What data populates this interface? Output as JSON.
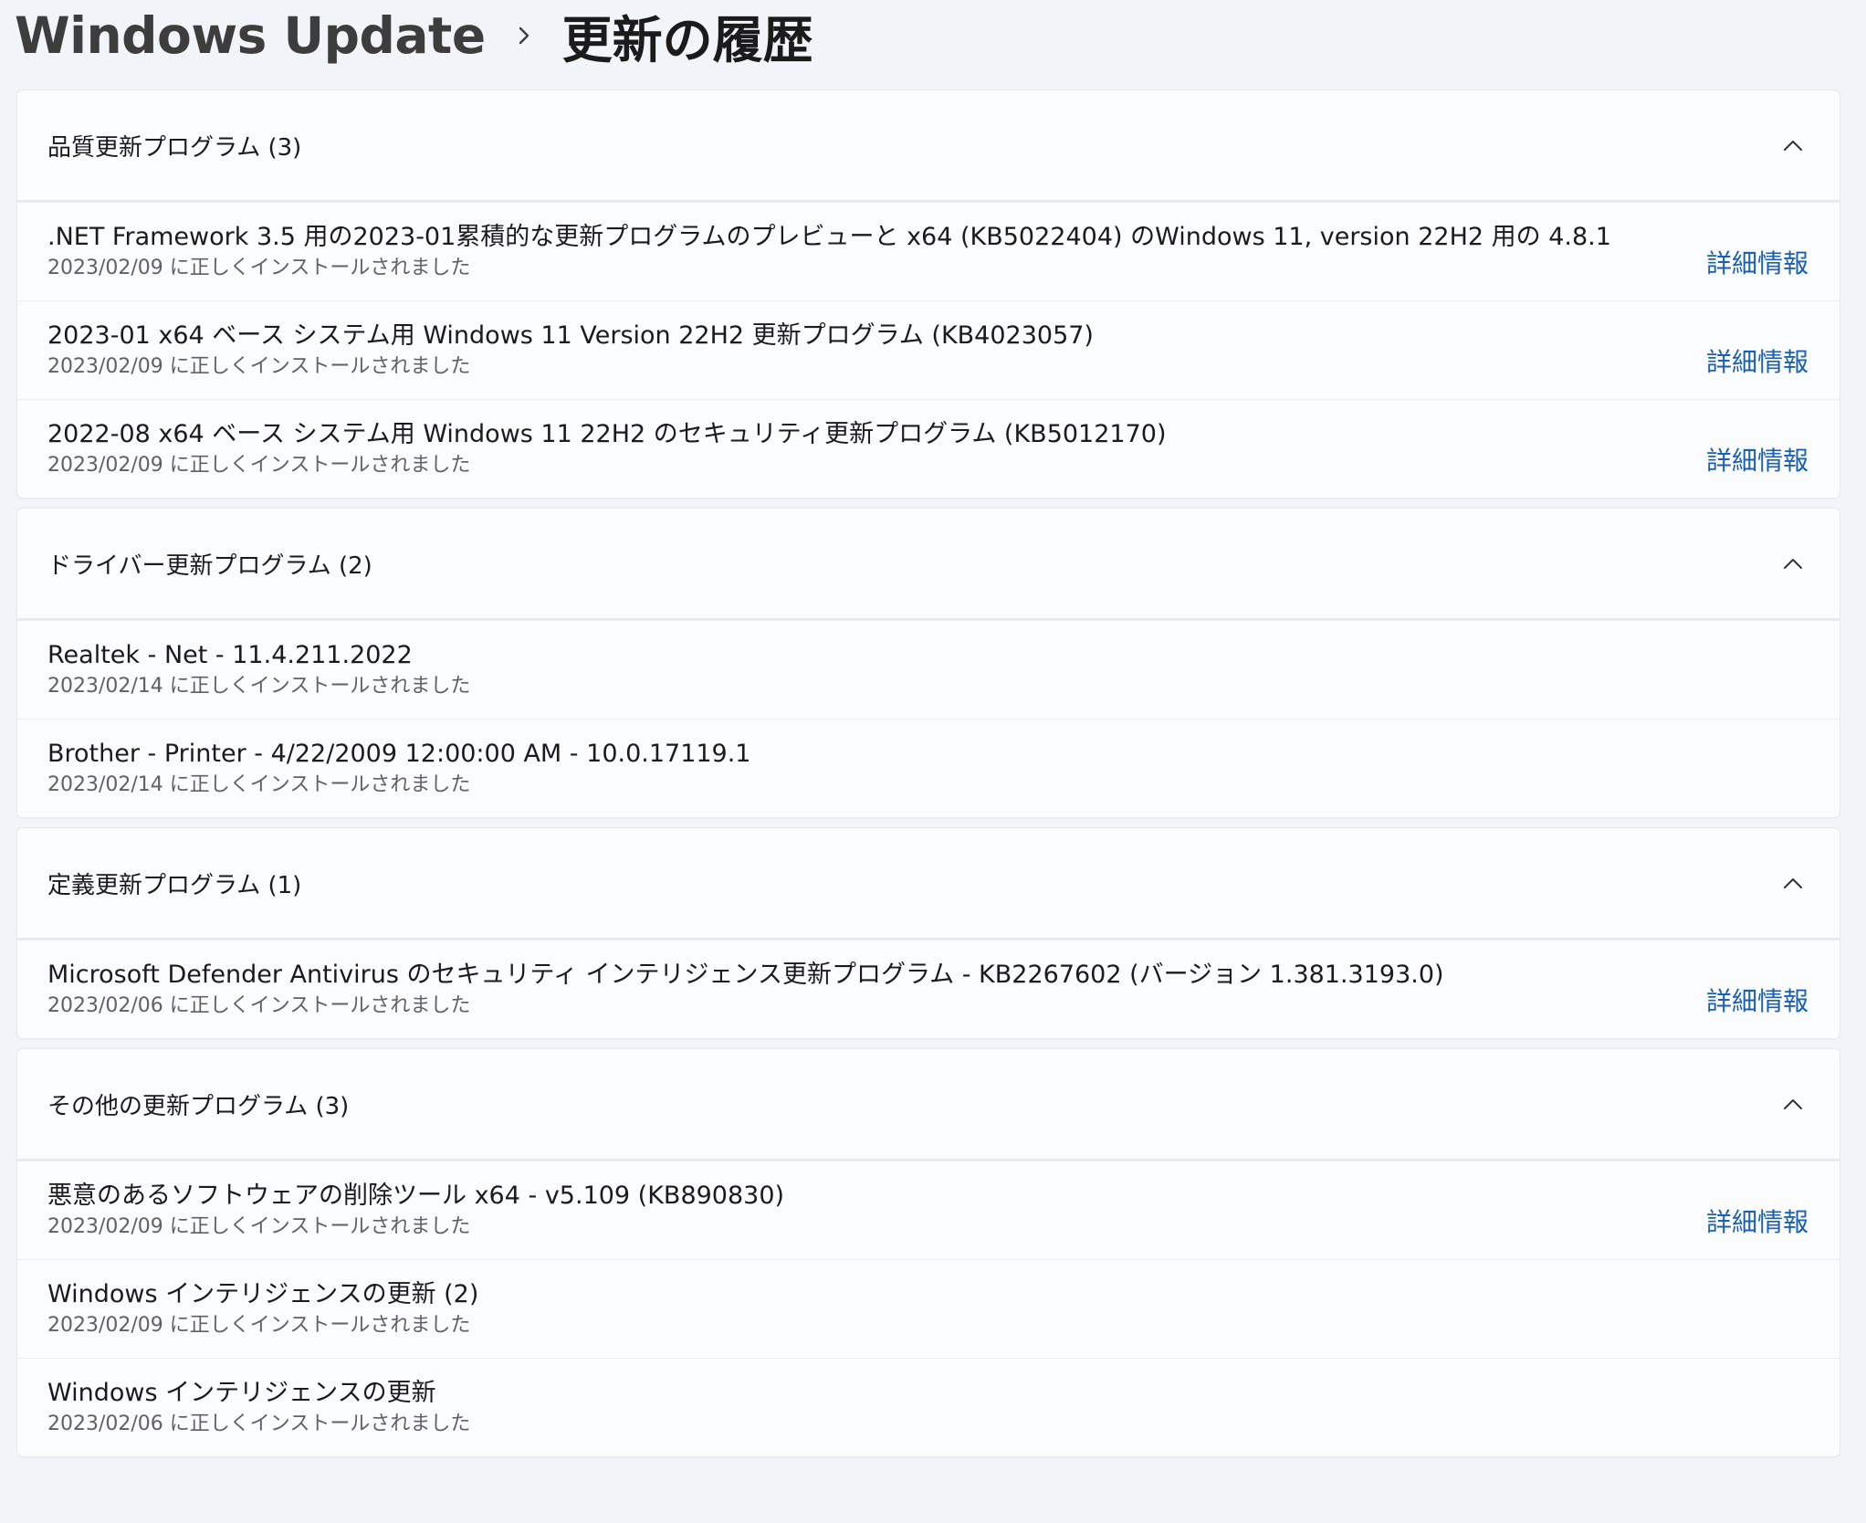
{
  "breadcrumb": {
    "parent": "Windows Update",
    "separator_icon": "chevron-right-icon",
    "current": "更新の履歴"
  },
  "groups": [
    {
      "title": "品質更新プログラム (3)",
      "expanded": true,
      "items": [
        {
          "title": ".NET Framework 3.5 用の2023-01累積的な更新プログラムのプレビューと x64 (KB5022404) のWindows 11, version 22H2 用の 4.8.1",
          "status": "2023/02/09 に正しくインストールされました",
          "link": "詳細情報"
        },
        {
          "title": "2023-01 x64 ベース システム用 Windows 11 Version 22H2 更新プログラム (KB4023057)",
          "status": "2023/02/09 に正しくインストールされました",
          "link": "詳細情報"
        },
        {
          "title": "2022-08 x64 ベース システム用 Windows 11 22H2 のセキュリティ更新プログラム (KB5012170)",
          "status": "2023/02/09 に正しくインストールされました",
          "link": "詳細情報"
        }
      ]
    },
    {
      "title": "ドライバー更新プログラム (2)",
      "expanded": true,
      "items": [
        {
          "title": "Realtek - Net - 11.4.211.2022",
          "status": "2023/02/14 に正しくインストールされました",
          "link": null
        },
        {
          "title": "Brother - Printer - 4/22/2009 12:00:00 AM - 10.0.17119.1",
          "status": "2023/02/14 に正しくインストールされました",
          "link": null
        }
      ]
    },
    {
      "title": "定義更新プログラム (1)",
      "expanded": true,
      "items": [
        {
          "title": "Microsoft Defender Antivirus のセキュリティ インテリジェンス更新プログラム - KB2267602 (バージョン 1.381.3193.0)",
          "status": "2023/02/06 に正しくインストールされました",
          "link": "詳細情報"
        }
      ]
    },
    {
      "title": "その他の更新プログラム (3)",
      "expanded": true,
      "items": [
        {
          "title": "悪意のあるソフトウェアの削除ツール x64 - v5.109 (KB890830)",
          "status": "2023/02/09 に正しくインストールされました",
          "link": "詳細情報"
        },
        {
          "title": "Windows インテリジェンスの更新 (2)",
          "status": "2023/02/09 に正しくインストールされました",
          "link": null
        },
        {
          "title": "Windows インテリジェンスの更新",
          "status": "2023/02/06 に正しくインストールされました",
          "link": null
        }
      ]
    }
  ],
  "colors": {
    "background": "#f1f4f8",
    "card": "#fbfcfd",
    "link": "#1a5fb4",
    "secondary_text": "#616161"
  }
}
